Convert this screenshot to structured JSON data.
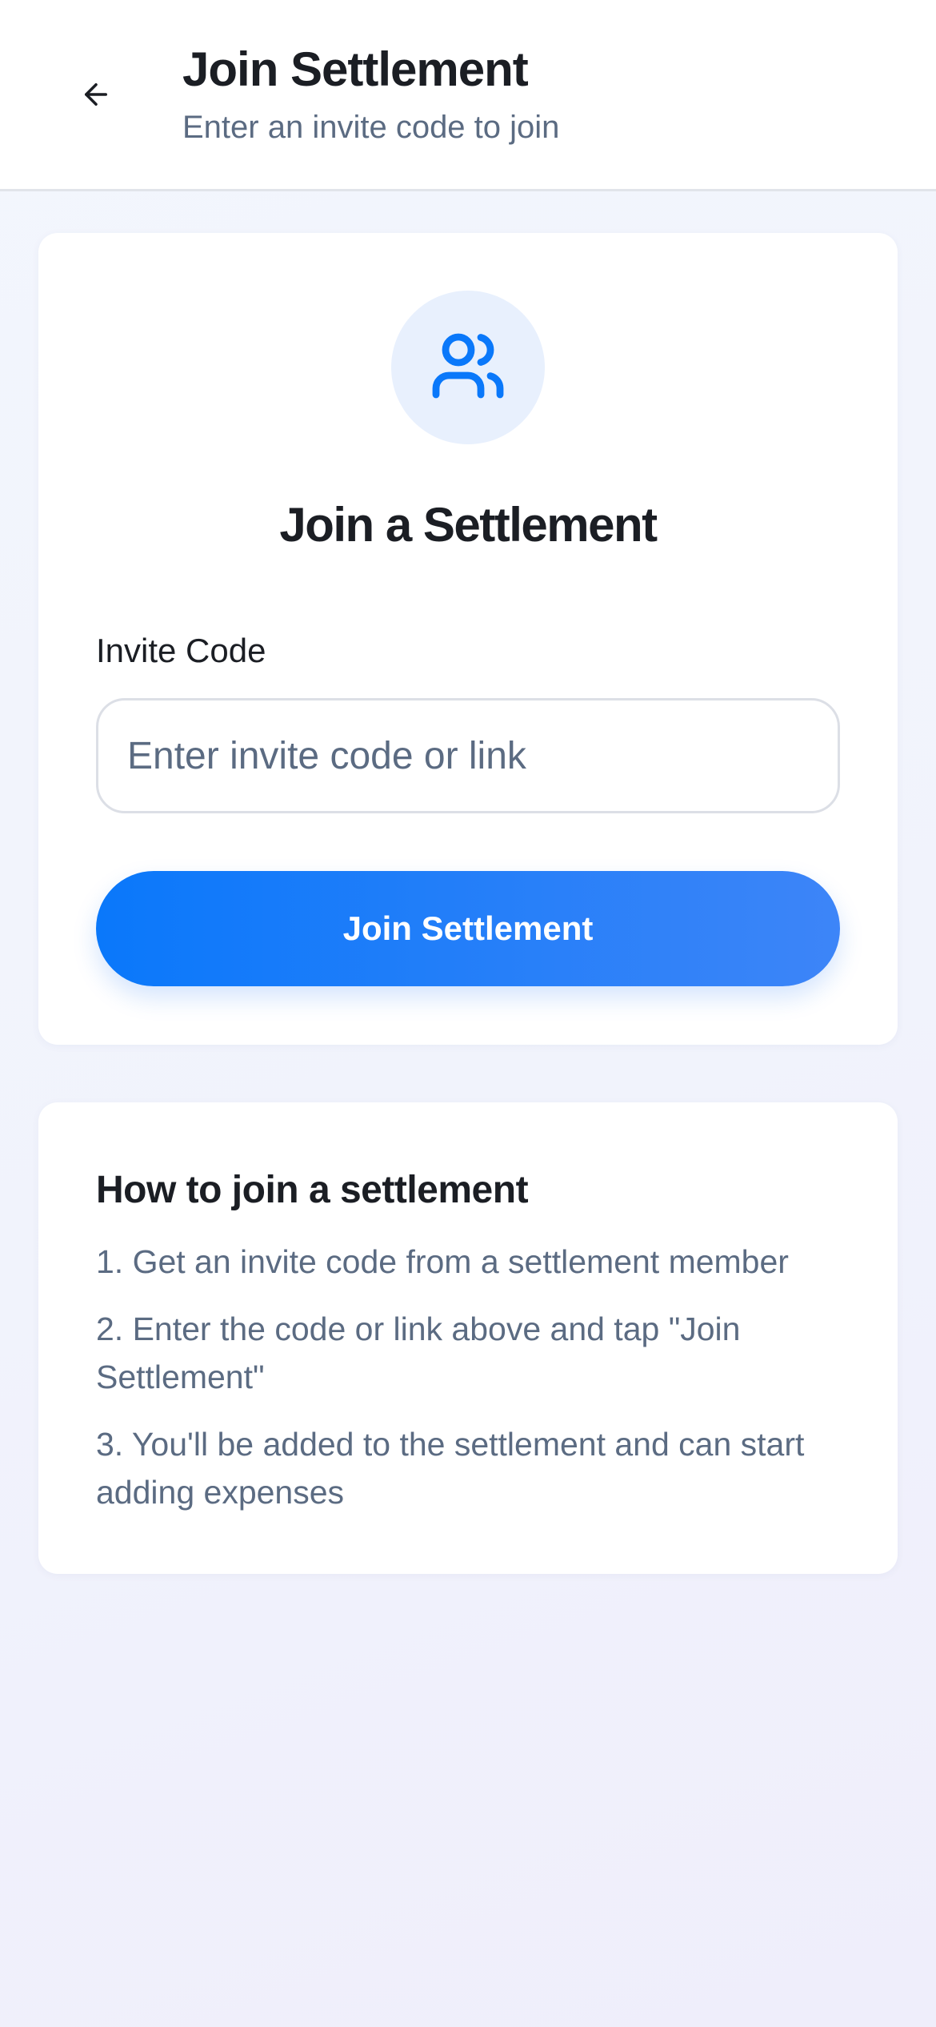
{
  "header": {
    "title": "Join Settlement",
    "subtitle": "Enter an invite code to join",
    "back_icon": "arrow-left-icon"
  },
  "join_card": {
    "icon": "users-icon",
    "title": "Join a Settlement",
    "invite_label": "Invite Code",
    "invite_placeholder": "Enter invite code or link",
    "invite_value": "",
    "button_label": "Join Settlement"
  },
  "howto_card": {
    "title": "How to join a settlement",
    "steps": [
      "1. Get an invite code from a settlement member",
      "2. Enter the code or link above and tap \"Join Settlement\"",
      "3. You'll be added to the settlement and can start adding expenses"
    ]
  },
  "colors": {
    "accent": "#0a78fa",
    "accent_end": "#3d85f8",
    "icon_bg": "#e8f0fd",
    "muted_text": "#5b6b82"
  }
}
